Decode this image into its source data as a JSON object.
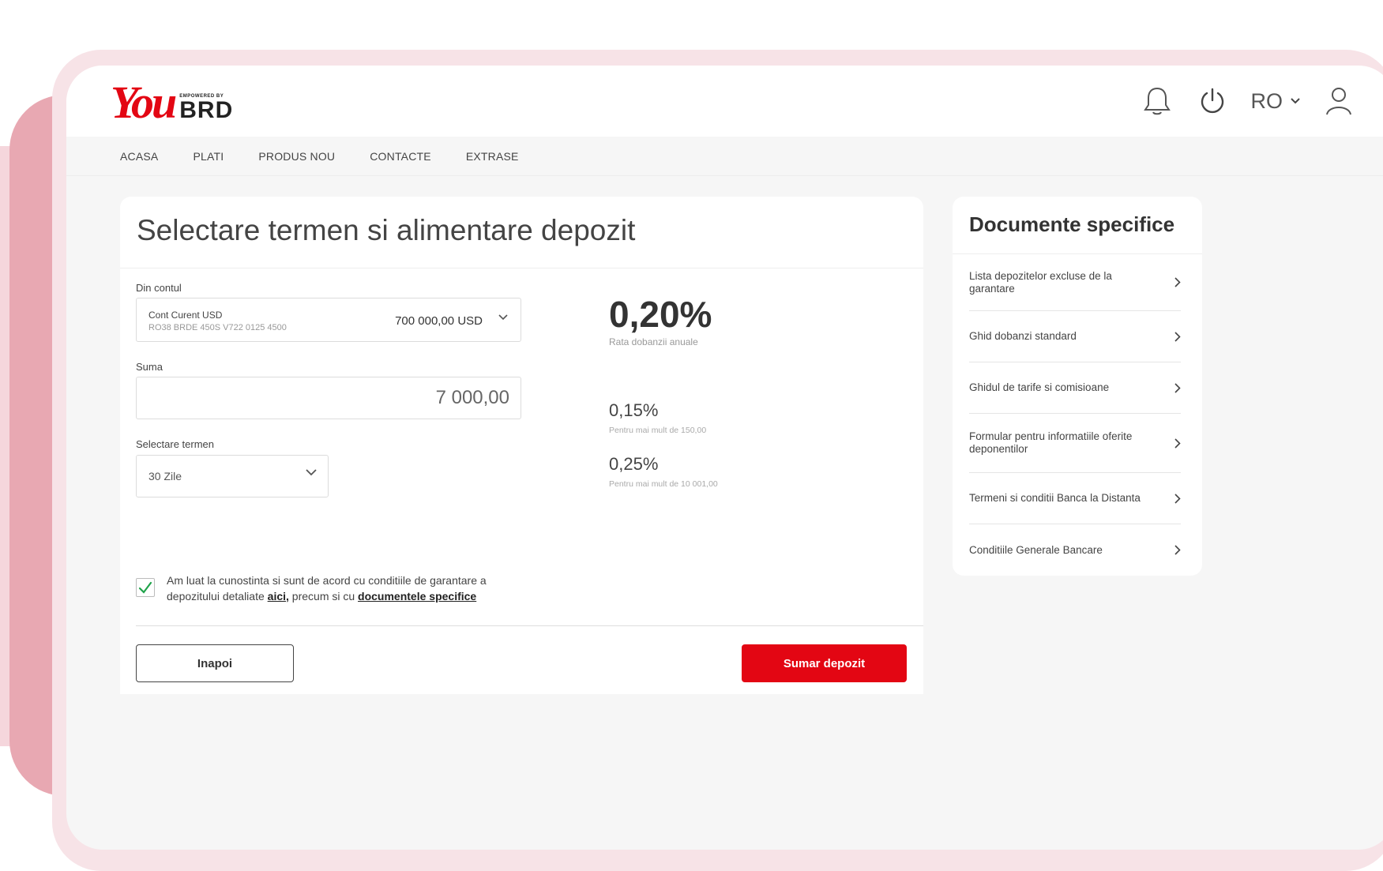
{
  "brand": {
    "logo_you": "You",
    "logo_tagline": "EMPOWERED BY",
    "logo_brd": "BRD",
    "primary_color": "#e30613"
  },
  "header": {
    "language": "RO",
    "icons": [
      "bell-icon",
      "power-icon",
      "chevron-down-icon",
      "user-icon"
    ]
  },
  "nav": {
    "items": [
      "ACASA",
      "PLATI",
      "PRODUS NOU",
      "CONTACTE",
      "EXTRASE"
    ]
  },
  "form": {
    "title": "Selectare termen si alimentare depozit",
    "from_account_label": "Din contul",
    "account_name": "Cont Curent USD",
    "account_iban": "RO38 BRDE 450S V722 0125 4500",
    "account_balance": "700 000,00 USD",
    "amount_label": "Suma",
    "amount_value": "7 000,00",
    "term_label": "Selectare termen",
    "term_value": "30 Zile",
    "consent_text_1": "Am luat la cunostinta si sunt de acord cu conditiile de garantare a depozitului detaliate ",
    "consent_link_1": "aici,",
    "consent_text_2": " precum si cu ",
    "consent_link_2": "documentele specifice",
    "consent_checked": true,
    "back_button": "Inapoi",
    "summary_button": "Sumar depozit"
  },
  "rates": {
    "main_rate": "0,20%",
    "main_rate_label": "Rata dobanzii anuale",
    "tier1_rate": "0,15%",
    "tier1_label": "Pentru mai mult de 150,00",
    "tier2_rate": "0,25%",
    "tier2_label": "Pentru mai mult de 10 001,00"
  },
  "documents": {
    "title": "Documente specifice",
    "items": [
      "Lista depozitelor excluse de la garantare",
      "Ghid dobanzi standard",
      "Ghidul de tarife si comisioane",
      "Formular pentru informatiile oferite deponentilor",
      "Termeni si conditii Banca la Distanta",
      "Conditiile Generale Bancare"
    ]
  }
}
